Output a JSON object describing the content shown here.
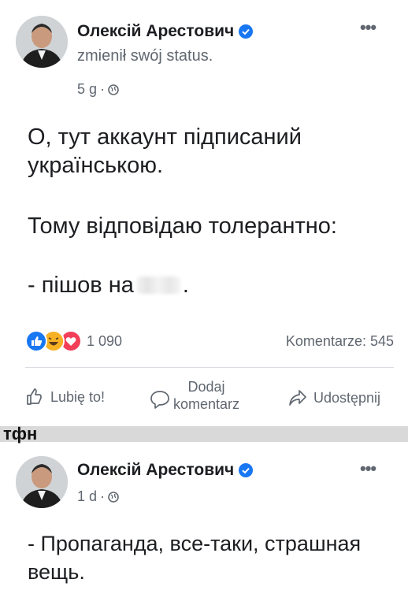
{
  "post1": {
    "author": "Олексій Арестович",
    "subtitle": "zmienił swój status.",
    "time": "5 g",
    "text_lines": [
      "О, тут аккаунт підписаний",
      "українською.",
      "Тому відповідаю толерантно:"
    ],
    "line4_prefix": "- пішов на",
    "line4_suffix": ".",
    "reaction_count": "1 090",
    "comments_count": "Komentarze: 545",
    "actions": {
      "like": "Lubię to!",
      "comment_line1": "Dodaj",
      "comment_line2": "komentarz",
      "share": "Udostępnij"
    }
  },
  "separator_label": "тфн",
  "post2": {
    "author": "Олексій Арестович",
    "time": "1 d",
    "text_lines": [
      "- Пропаганда, все-таки, страшная",
      "вещь."
    ]
  },
  "colors": {
    "verified": "#1877f2",
    "like": "#1877f2",
    "love": "#f33e58",
    "haha": "#f7b125",
    "secondary_text": "#606770"
  },
  "icons": [
    "verified-icon",
    "more-options-icon",
    "globe-icon",
    "like-reaction-icon",
    "haha-reaction-icon",
    "love-reaction-icon",
    "thumbs-up-icon",
    "comment-icon",
    "share-icon"
  ]
}
